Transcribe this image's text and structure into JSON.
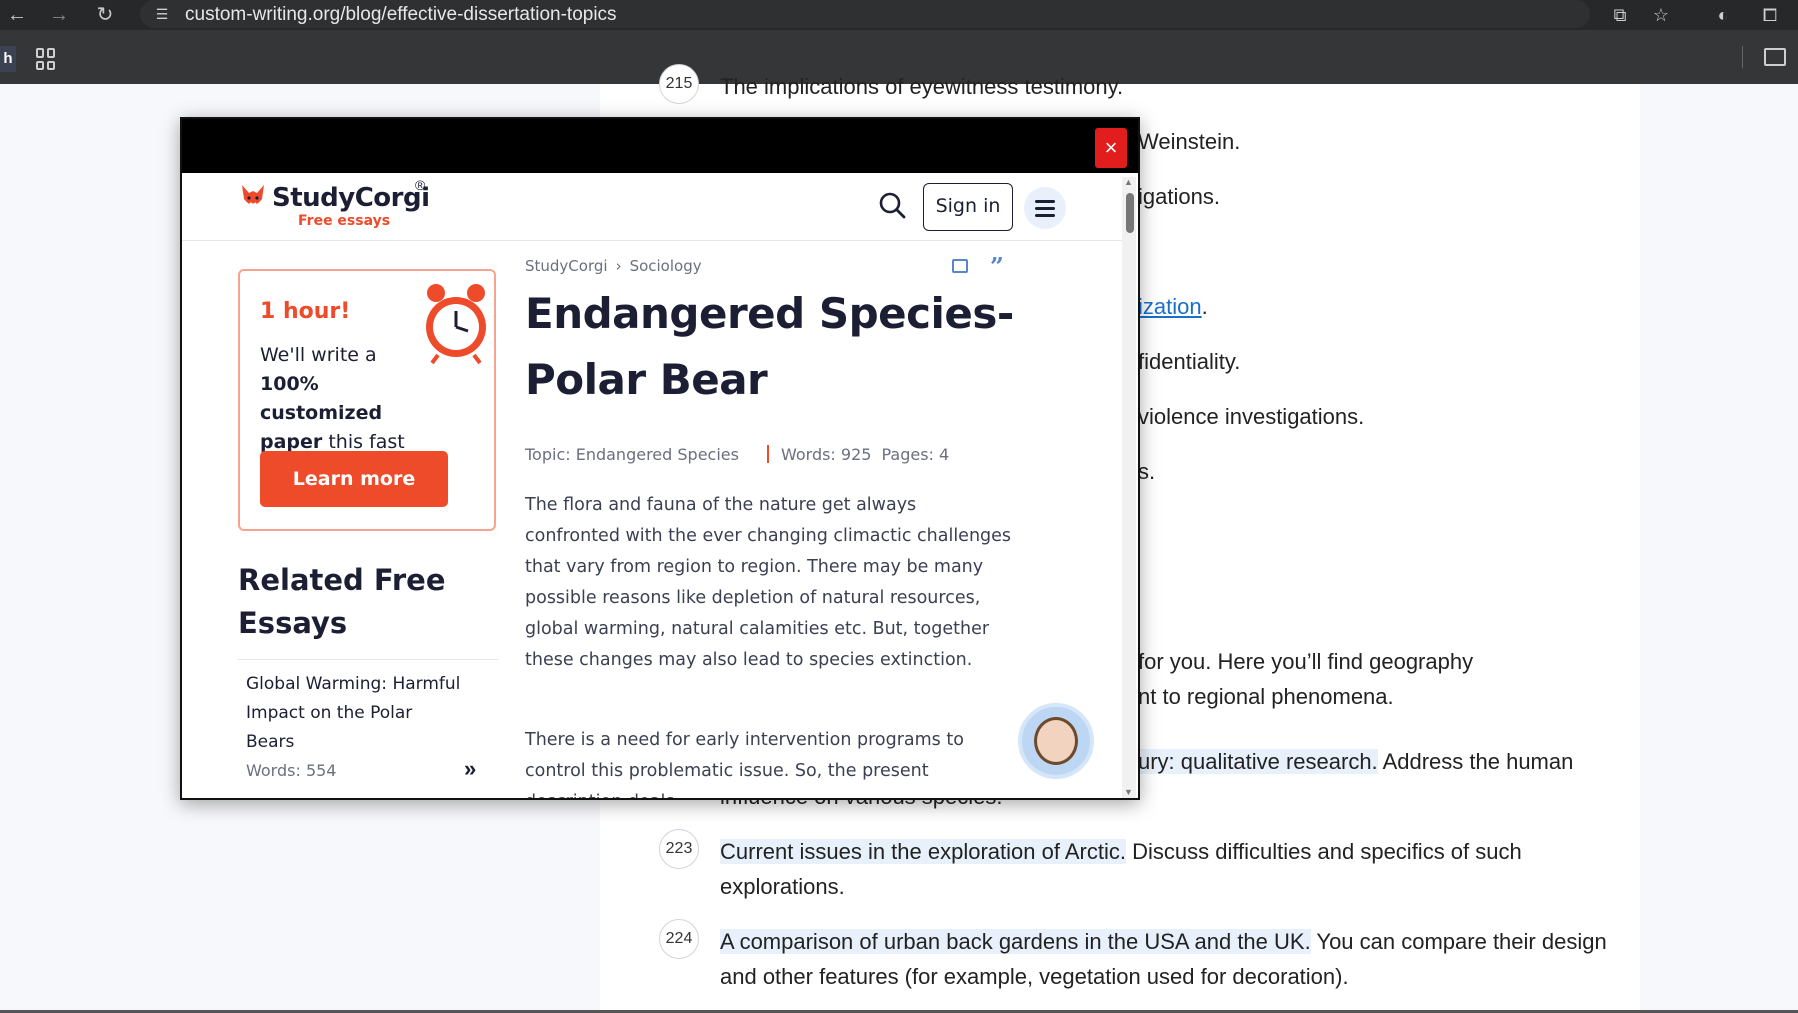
{
  "browser": {
    "url": "custom-writing.org/blog/effective-dissertation-topics",
    "tab_letter": "h"
  },
  "background_article": {
    "lines": [
      {
        "num": "215",
        "text": "The implications of eyewitness testimony."
      },
      {
        "text": "Weinstein."
      },
      {
        "text": "igations."
      },
      {
        "link": "ization",
        "tail": "."
      },
      {
        "text": "fidentiality."
      },
      {
        "text": "violence investigations."
      },
      {
        "text": "s."
      },
      {
        "text": "for you. Here you’ll find geography"
      },
      {
        "text": "nt to regional phenomena."
      },
      {
        "highlight": "ury: qualitative research.",
        "tail": " Address the human"
      },
      {
        "text": "influence on various species."
      }
    ],
    "items": [
      {
        "num": "223",
        "highlight": "Current issues in the exploration of Arctic.",
        "tail": " Discuss difficulties and specifics of such",
        "line2": "explorations."
      },
      {
        "num": "224",
        "highlight": "A comparison of urban back gardens in the USA and the UK.",
        "tail": " You can compare their design",
        "line2": "and other features (for example, vegetation used for decoration)."
      }
    ]
  },
  "popup": {
    "close_label": "×",
    "header": {
      "logo_text": "StudyCorgi",
      "logo_reg": "®",
      "logo_sub": "Free essays",
      "signin_label": "Sign in"
    },
    "promo": {
      "title": "1 hour!",
      "line1": "We'll write a",
      "line2_bold": "100% customized",
      "line3_bold": "paper",
      "line3_rest": " this fast",
      "button": "Learn more"
    },
    "related": {
      "title": "Related Free Essays",
      "item_title": "Global Warming: Harmful Impact on the Polar Bears",
      "item_words": "Words: 554"
    },
    "breadcrumb": [
      "StudyCorgi",
      "Sociology"
    ],
    "essay": {
      "title": "Endangered Species- Polar Bear",
      "topic": "Topic: Endangered Species",
      "words": "Words: 925",
      "pages": "Pages: 4",
      "para1": "The flora and fauna of the nature get always confronted with the ever changing climactic challenges that vary from region to region. There may be many possible reasons like depletion of natural resources, global warming, natural calamities etc. But, together these changes may also lead to species extinction.",
      "para2": "There is a need for early intervention programs to control this problematic issue. So, the present description deals"
    }
  }
}
